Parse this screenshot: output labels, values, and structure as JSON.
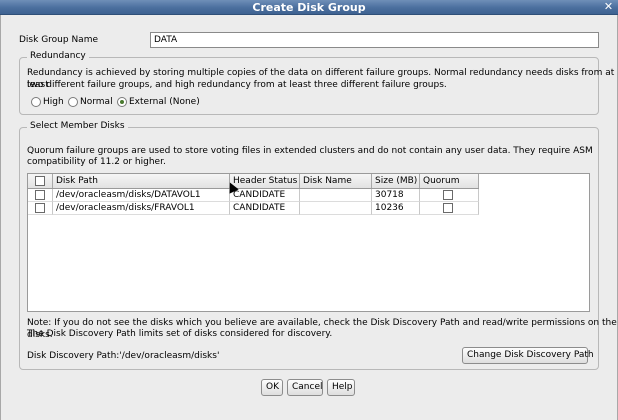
{
  "window": {
    "title": "Create Disk Group",
    "close_glyph": "✕"
  },
  "disk_group_name": {
    "label": "Disk Group Name",
    "value": "DATA"
  },
  "redundancy": {
    "group_title": "Redundancy",
    "description_line1": "Redundancy is achieved by storing multiple copies of the data on different failure groups. Normal redundancy needs disks from at least",
    "description_line2": "two different failure groups, and high redundancy from at least three different failure groups.",
    "options": [
      {
        "label": "High",
        "selected": false
      },
      {
        "label": "Normal",
        "selected": false
      },
      {
        "label": "External (None)",
        "selected": true
      }
    ]
  },
  "member_disks": {
    "group_title": "Select Member Disks",
    "description_line1": "Quorum failure groups are used to store voting files in extended clusters and do not contain any user data. They require ASM",
    "description_line2": "compatibility of 11.2 or higher.",
    "columns": [
      "Disk Path",
      "Header Status",
      "Disk Name",
      "Size (MB)",
      "Quorum"
    ],
    "rows": [
      {
        "disk_path": "/dev/oracleasm/disks/DATAVOL1",
        "header_status": "CANDIDATE",
        "disk_name": "",
        "size_mb": "30718",
        "quorum": false,
        "selected": false
      },
      {
        "disk_path": "/dev/oracleasm/disks/FRAVOL1",
        "header_status": "CANDIDATE",
        "disk_name": "",
        "size_mb": "10236",
        "quorum": false,
        "selected": false
      }
    ],
    "note_line1": "Note: If you do not see the disks which you believe are available, check the Disk Discovery Path and read/write permissions on the disks.",
    "note_line2": "The Disk Discovery Path limits set of disks considered for discovery.",
    "discovery_path_label": "Disk Discovery Path:'/dev/oracleasm/disks'",
    "change_path_button": "Change Disk Discovery Path"
  },
  "buttons": {
    "ok": "OK",
    "cancel": "Cancel",
    "help": "Help"
  }
}
